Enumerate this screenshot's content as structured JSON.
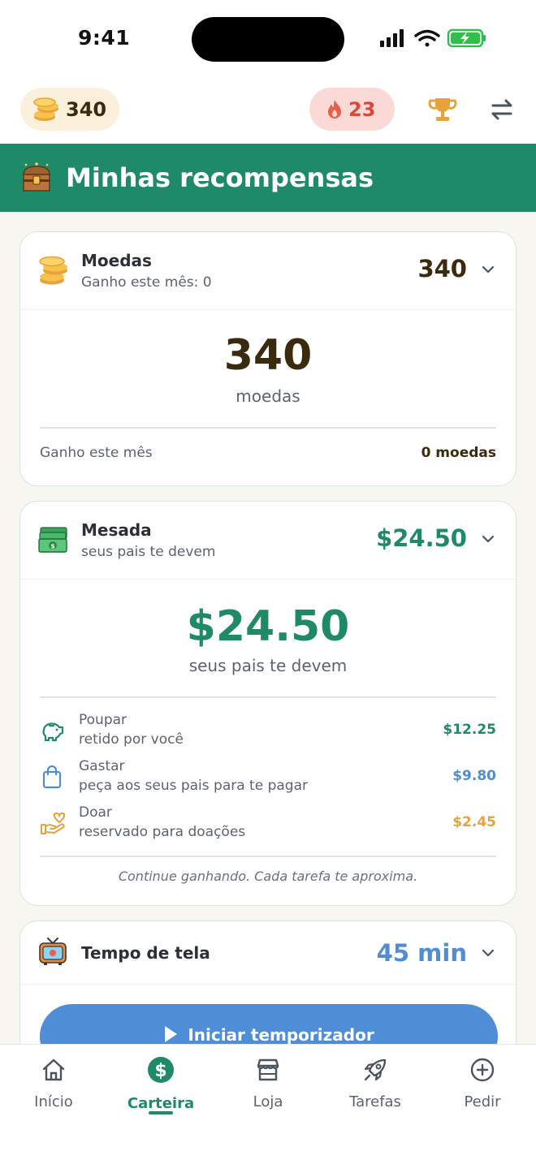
{
  "status": {
    "time": "9:41"
  },
  "topbar": {
    "coins": "340",
    "streak": "23"
  },
  "header": {
    "title": "Minhas recompensas"
  },
  "coins_card": {
    "title": "Moedas",
    "subtitle": "Ganho este mês: 0",
    "value": "340",
    "big_value": "340",
    "big_unit": "moedas",
    "footer_label": "Ganho este mês",
    "footer_value": "0 moedas"
  },
  "allowance_card": {
    "title": "Mesada",
    "subtitle": "seus pais te devem",
    "value": "$24.50",
    "big_value": "$24.50",
    "big_caption": "seus pais te devem",
    "rows": [
      {
        "name": "Poupar",
        "desc": "retido por você",
        "value": "$12.25",
        "color": "#1f8a68",
        "icon": "piggy-bank-icon"
      },
      {
        "name": "Gastar",
        "desc": "peça aos seus pais para te pagar",
        "value": "$9.80",
        "color": "#4f8ed6",
        "icon": "shopping-bag-icon"
      },
      {
        "name": "Doar",
        "desc": "reservado para doações",
        "value": "$2.45",
        "color": "#e9a23b",
        "icon": "heart-hand-icon"
      }
    ],
    "note": "Continue ganhando. Cada tarefa te aproxima."
  },
  "screen_card": {
    "title": "Tempo de tela",
    "value": "45 min",
    "button_label": "Iniciar temporizador"
  },
  "tabs": [
    {
      "label": "Início",
      "icon": "home-icon"
    },
    {
      "label": "Carteira",
      "icon": "dollar-icon",
      "active": true
    },
    {
      "label": "Loja",
      "icon": "store-icon"
    },
    {
      "label": "Tarefas",
      "icon": "rocket-icon"
    },
    {
      "label": "Pedir",
      "icon": "plus-circle-icon"
    }
  ],
  "colors": {
    "brand": "#1f8a68",
    "blue": "#4f8ed6",
    "orange": "#e9a23b",
    "coin_text": "#3a2a0e",
    "streak": "#d64a3a"
  }
}
